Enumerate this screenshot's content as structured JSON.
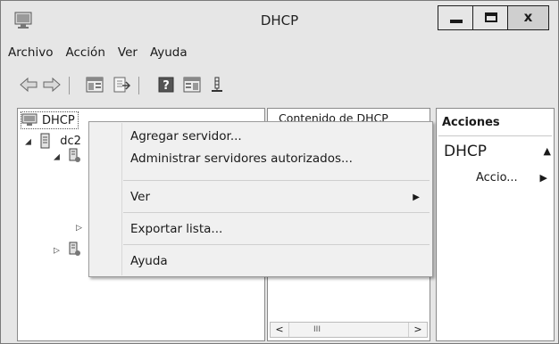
{
  "window": {
    "title": "DHCP",
    "close_glyph": "x"
  },
  "icons": {
    "app": "dhcp-server-icon"
  },
  "menubar": {
    "items": [
      "Archivo",
      "Acción",
      "Ver",
      "Ayuda"
    ]
  },
  "tree": {
    "root_label": "DHCP",
    "server_label": "dc2"
  },
  "content": {
    "header": "Contenido de DHCP",
    "scroll_thumb": "III",
    "scroll_left": "<",
    "scroll_right": ">"
  },
  "actions": {
    "title": "Acciones",
    "section": "DHCP",
    "item": "Accio..."
  },
  "context_menu": {
    "items": [
      "Agregar servidor...",
      "Administrar servidores autorizados...",
      "Ver",
      "Exportar lista...",
      "Ayuda"
    ]
  }
}
